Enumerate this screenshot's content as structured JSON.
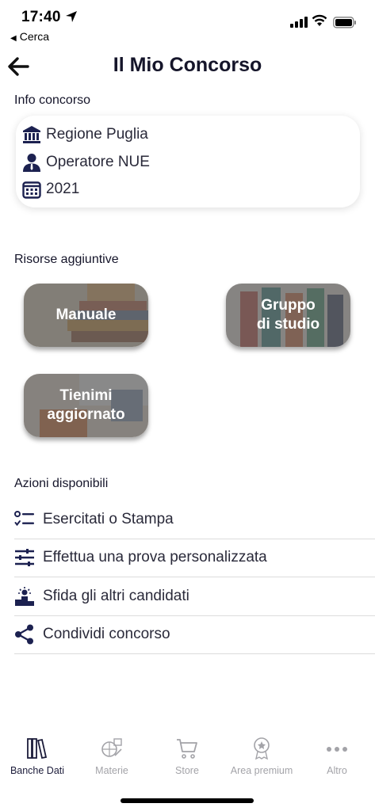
{
  "status": {
    "time": "17:40",
    "back_app": "Cerca"
  },
  "header": {
    "title": "Il Mio Concorso"
  },
  "info": {
    "section_title": "Info concorso",
    "rows": [
      {
        "icon": "bank-icon",
        "text": "Regione Puglia"
      },
      {
        "icon": "person-icon",
        "text": "Operatore NUE"
      },
      {
        "icon": "calendar-icon",
        "text": "2021"
      }
    ]
  },
  "resources": {
    "section_title": "Risorse aggiuntive",
    "buttons": [
      {
        "line1": "Manuale",
        "line2": ""
      },
      {
        "line1": "Gruppo",
        "line2": "di studio"
      },
      {
        "line1": "Tienimi",
        "line2": "aggiornato"
      }
    ]
  },
  "actions": {
    "section_title": "Azioni disponibili",
    "items": [
      {
        "icon": "checklist-icon",
        "label": "Esercitati o Stampa"
      },
      {
        "icon": "sliders-icon",
        "label": "Effettua una prova personalizzata"
      },
      {
        "icon": "podium-icon",
        "label": "Sfida gli altri candidati"
      },
      {
        "icon": "share-icon",
        "label": "Condividi concorso"
      }
    ]
  },
  "tabs": [
    {
      "icon": "books-icon",
      "label": "Banche Dati",
      "active": true
    },
    {
      "icon": "subjects-icon",
      "label": "Materie",
      "active": false
    },
    {
      "icon": "cart-icon",
      "label": "Store",
      "active": false
    },
    {
      "icon": "premium-badge-icon",
      "label": "Area premium",
      "active": false
    },
    {
      "icon": "more-icon",
      "label": "Altro",
      "active": false
    }
  ],
  "colors": {
    "text_dark": "#15152a",
    "tab_active": "#1c1c3a",
    "tab_inactive": "#a3a3a8",
    "button_overlay": "#5f5f5f"
  }
}
